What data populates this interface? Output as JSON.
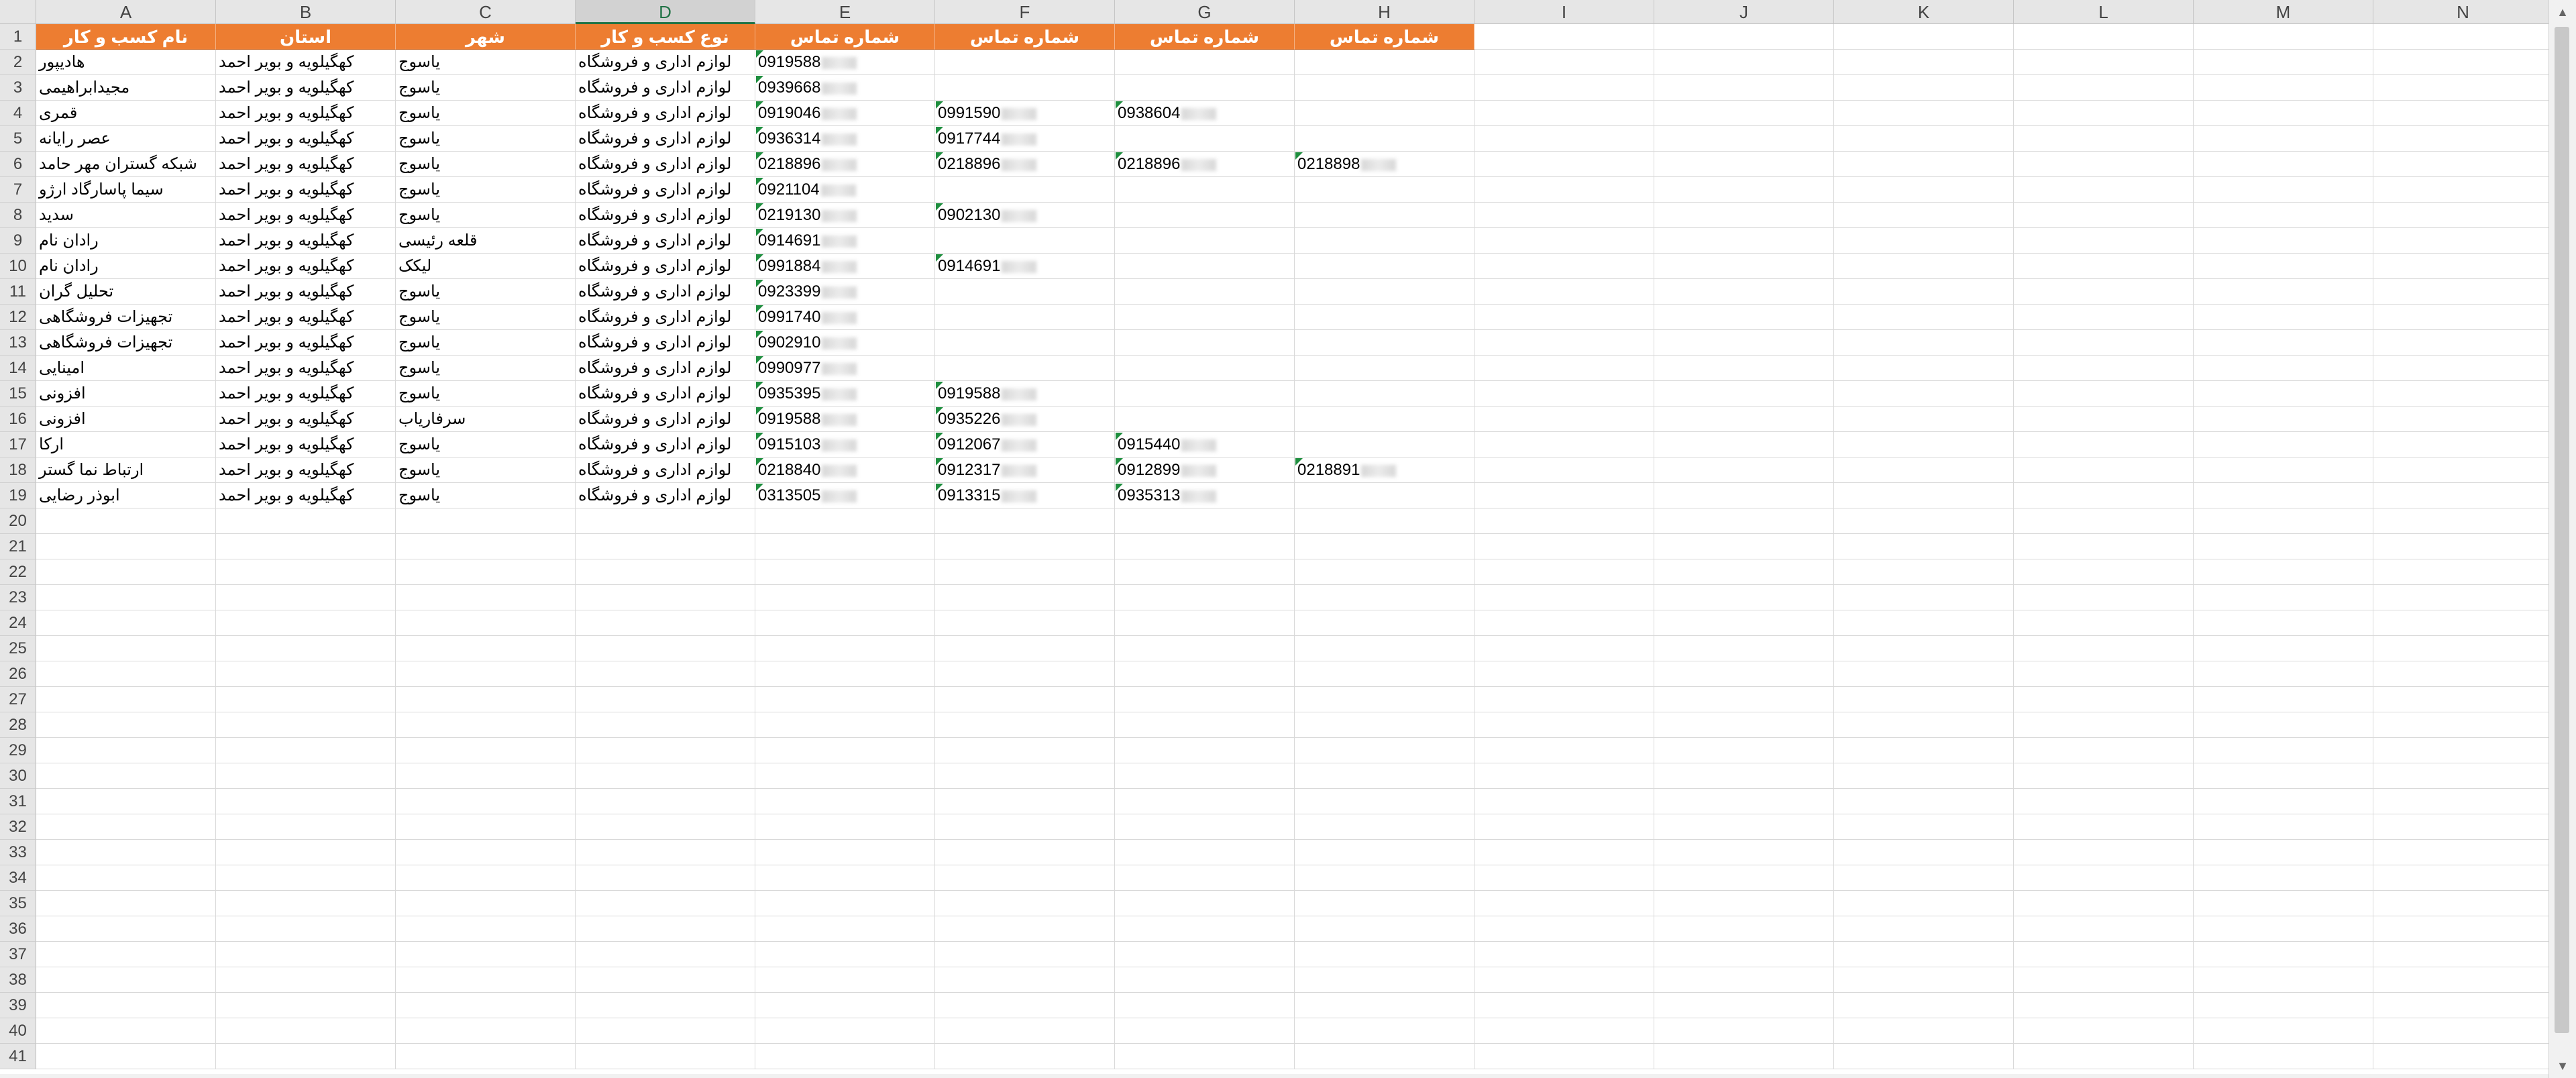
{
  "columns": [
    "A",
    "B",
    "C",
    "D",
    "E",
    "F",
    "G",
    "H",
    "I",
    "J",
    "K",
    "L",
    "M",
    "N"
  ],
  "selected_column": "D",
  "row_numbers": [
    1,
    2,
    3,
    4,
    5,
    6,
    7,
    8,
    9,
    10,
    11,
    12,
    13,
    14,
    15,
    16,
    17,
    18,
    19,
    20,
    21,
    22,
    23,
    24,
    25,
    26,
    27,
    28,
    29,
    30,
    31,
    32,
    33,
    34,
    35,
    36,
    37,
    38,
    39,
    40,
    41
  ],
  "headers": {
    "A": "نام کسب و کار",
    "B": "استان",
    "C": "شهر",
    "D": "نوع کسب و کار",
    "E": "شماره تماس",
    "F": "شماره تماس",
    "G": "شماره تماس",
    "H": "شماره تماس"
  },
  "rows": [
    {
      "A": "هادیپور",
      "B": "کهگیلویه و بویر احمد",
      "C": "یاسوج",
      "D": "لوازم اداری و فروشگاه",
      "E": "0919588",
      "F": "",
      "G": "",
      "H": ""
    },
    {
      "A": "مجیدابراهیمی",
      "B": "کهگیلویه و بویر احمد",
      "C": "یاسوج",
      "D": "لوازم اداری و فروشگاه",
      "E": "0939668",
      "F": "",
      "G": "",
      "H": ""
    },
    {
      "A": "قمری",
      "B": "کهگیلویه و بویر احمد",
      "C": "یاسوج",
      "D": "لوازم اداری و فروشگاه",
      "E": "0919046",
      "F": "0991590",
      "G": "0938604",
      "H": ""
    },
    {
      "A": "عصر رایانه",
      "B": "کهگیلویه و بویر احمد",
      "C": "یاسوج",
      "D": "لوازم اداری و فروشگاه",
      "E": "0936314",
      "F": "0917744",
      "G": "",
      "H": ""
    },
    {
      "A": "شبکه گستران مهر حامد",
      "B": "کهگیلویه و بویر احمد",
      "C": "یاسوج",
      "D": "لوازم اداری و فروشگاه",
      "E": "0218896",
      "F": "0218896",
      "G": "0218896",
      "H": "0218898"
    },
    {
      "A": "سیما پاسارگاد ارژو",
      "B": "کهگیلویه و بویر احمد",
      "C": "یاسوج",
      "D": "لوازم اداری و فروشگاه",
      "E": "0921104",
      "F": "",
      "G": "",
      "H": ""
    },
    {
      "A": "سدید",
      "B": "کهگیلویه و بویر احمد",
      "C": "یاسوج",
      "D": "لوازم اداری و فروشگاه",
      "E": "0219130",
      "F": "0902130",
      "G": "",
      "H": ""
    },
    {
      "A": "رادان نام",
      "B": "کهگیلویه و بویر احمد",
      "C": "قلعه رئیسی",
      "D": "لوازم اداری و فروشگاه",
      "E": "0914691",
      "F": "",
      "G": "",
      "H": ""
    },
    {
      "A": "رادان نام",
      "B": "کهگیلویه و بویر احمد",
      "C": "لیکک",
      "D": "لوازم اداری و فروشگاه",
      "E": "0991884",
      "F": "0914691",
      "G": "",
      "H": ""
    },
    {
      "A": "تحلیل گران",
      "B": "کهگیلویه و بویر احمد",
      "C": "یاسوج",
      "D": "لوازم اداری و فروشگاه",
      "E": "0923399",
      "F": "",
      "G": "",
      "H": ""
    },
    {
      "A": "تجهیزات فروشگاهی",
      "B": "کهگیلویه و بویر احمد",
      "C": "یاسوج",
      "D": "لوازم اداری و فروشگاه",
      "E": "0991740",
      "F": "",
      "G": "",
      "H": ""
    },
    {
      "A": "تجهیزات فروشگاهی",
      "B": "کهگیلویه و بویر احمد",
      "C": "یاسوج",
      "D": "لوازم اداری و فروشگاه",
      "E": "0902910",
      "F": "",
      "G": "",
      "H": ""
    },
    {
      "A": "امینایی",
      "B": "کهگیلویه و بویر احمد",
      "C": "یاسوج",
      "D": "لوازم اداری و فروشگاه",
      "E": "0990977",
      "F": "",
      "G": "",
      "H": ""
    },
    {
      "A": "افزونی",
      "B": "کهگیلویه و بویر احمد",
      "C": "یاسوج",
      "D": "لوازم اداری و فروشگاه",
      "E": "0935395",
      "F": "0919588",
      "G": "",
      "H": ""
    },
    {
      "A": "افزونی",
      "B": "کهگیلویه و بویر احمد",
      "C": "سرفاریاب",
      "D": "لوازم اداری و فروشگاه",
      "E": "0919588",
      "F": "0935226",
      "G": "",
      "H": ""
    },
    {
      "A": "ارکا",
      "B": "کهگیلویه و بویر احمد",
      "C": "یاسوج",
      "D": "لوازم اداری و فروشگاه",
      "E": "0915103",
      "F": "0912067",
      "G": "0915440",
      "H": ""
    },
    {
      "A": "ارتباط نما گستر",
      "B": "کهگیلویه و بویر احمد",
      "C": "یاسوج",
      "D": "لوازم اداری و فروشگاه",
      "E": "0218840",
      "F": "0912317",
      "G": "0912899",
      "H": "0218891"
    },
    {
      "A": "ابوذر رضایی",
      "B": "کهگیلویه و بویر احمد",
      "C": "یاسوج",
      "D": "لوازم اداری و فروشگاه",
      "E": "0313505",
      "F": "0913315",
      "G": "0935313",
      "H": ""
    }
  ],
  "header_fill_color": "#ed7d31",
  "selection_color": "#217346"
}
